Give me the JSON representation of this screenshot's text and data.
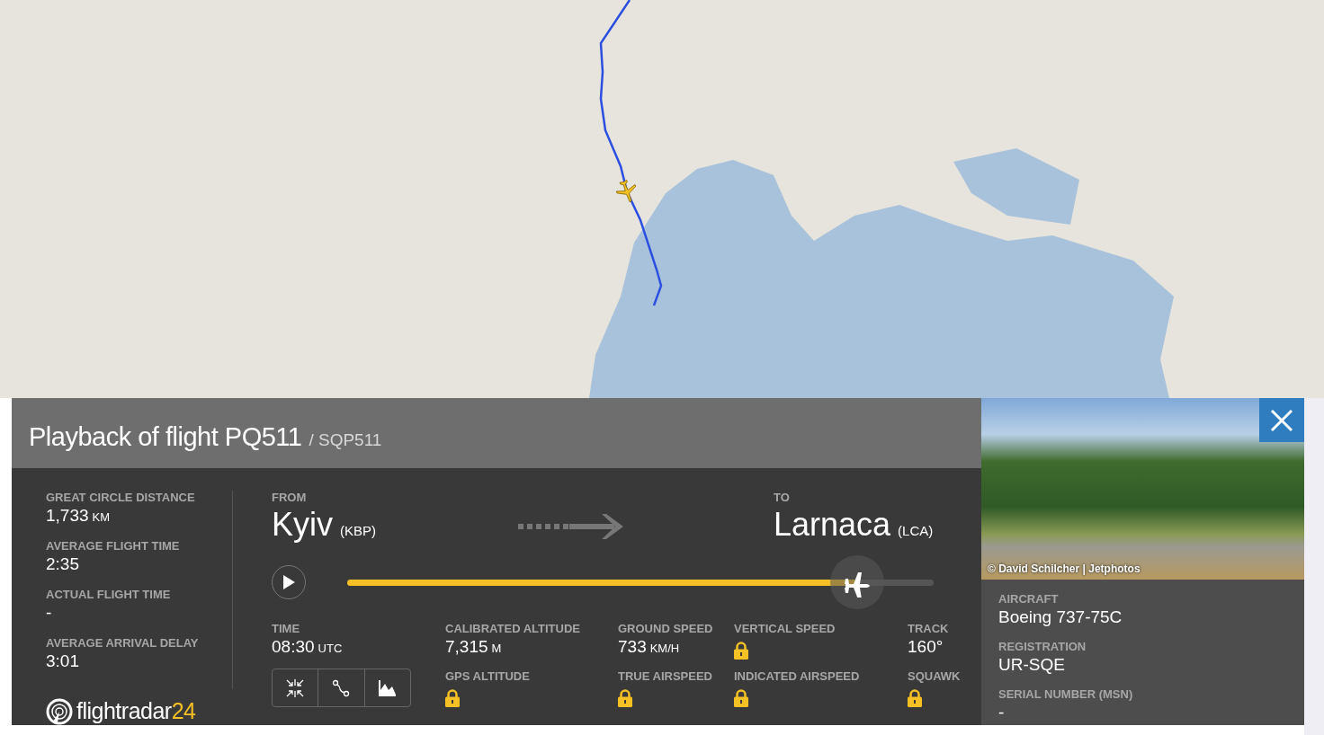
{
  "title": {
    "text": "Playback of flight PQ511",
    "callsign": "/ SQP511"
  },
  "summary": [
    {
      "label": "GREAT CIRCLE DISTANCE",
      "value": "1,733",
      "unit": "KM"
    },
    {
      "label": "AVERAGE FLIGHT TIME",
      "value": "2:35"
    },
    {
      "label": "ACTUAL FLIGHT TIME",
      "value": "-"
    },
    {
      "label": "AVERAGE ARRIVAL DELAY",
      "value": "3:01"
    }
  ],
  "logo": {
    "text": "flightradar",
    "suffix": "24"
  },
  "from": {
    "label": "FROM",
    "city": "Kyiv",
    "code": "(KBP)"
  },
  "to": {
    "label": "TO",
    "city": "Larnaca",
    "code": "(LCA)"
  },
  "playback": {
    "playing": false,
    "level": 0.87
  },
  "time": {
    "label": "TIME",
    "value": "08:30",
    "unit": "UTC"
  },
  "telemetry": [
    {
      "label": "CALIBRATED ALTITUDE",
      "value": "7,315",
      "unit": "M",
      "locked": false
    },
    {
      "label": "GROUND SPEED",
      "value": "733",
      "unit": "KM/H",
      "locked": false
    },
    {
      "label": "VERTICAL SPEED",
      "locked": true
    },
    {
      "label": "TRACK",
      "value": "160°",
      "locked": false
    },
    {
      "label": "GPS ALTITUDE",
      "locked": true
    },
    {
      "label": "TRUE AIRSPEED",
      "locked": true
    },
    {
      "label": "INDICATED AIRSPEED",
      "locked": true
    },
    {
      "label": "SQUAWK",
      "locked": true
    }
  ],
  "photo": {
    "credit": "© David Schilcher | Jetphotos"
  },
  "aircraft": [
    {
      "label": "AIRCRAFT",
      "value": "Boeing 737-75C"
    },
    {
      "label": "REGISTRATION",
      "value": "UR-SQE"
    },
    {
      "label": "SERIAL NUMBER (MSN)",
      "value": "-"
    }
  ]
}
